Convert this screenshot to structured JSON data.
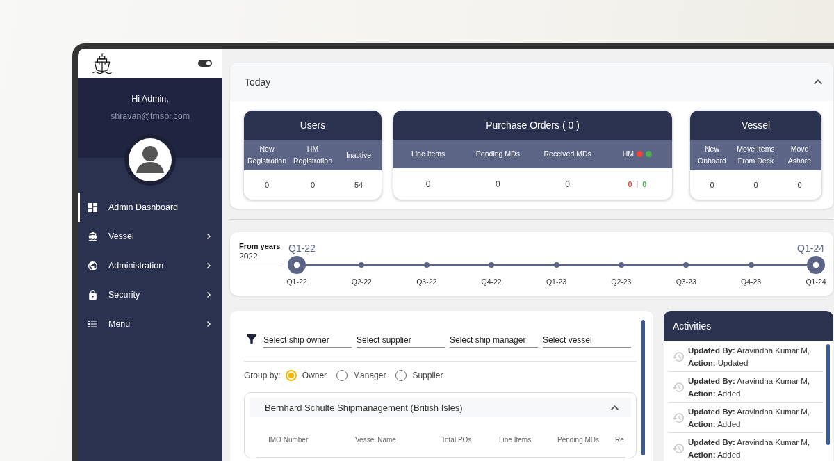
{
  "sidebar": {
    "theme_toggle": {
      "on": true
    },
    "greeting": "Hi Admin,",
    "email": "shravan@tmspl.com",
    "items": [
      {
        "label": "Admin Dashboard",
        "selected": true,
        "has_submenu": false
      },
      {
        "label": "Vessel",
        "selected": false,
        "has_submenu": true
      },
      {
        "label": "Administration",
        "selected": false,
        "has_submenu": true
      },
      {
        "label": "Security",
        "selected": false,
        "has_submenu": true
      },
      {
        "label": "Menu",
        "selected": false,
        "has_submenu": true
      }
    ]
  },
  "today": {
    "title": "Today",
    "expanded": true,
    "cards": [
      {
        "title": "Users",
        "columns": [
          {
            "kind": "plain",
            "label": "New Registration",
            "value": "0"
          },
          {
            "kind": "plain",
            "label": "HM Registration",
            "value": "0"
          },
          {
            "kind": "plain",
            "label": "Inactive",
            "value": "54"
          }
        ]
      },
      {
        "title": "Purchase Orders ( 0 )",
        "columns": [
          {
            "kind": "plain",
            "label": "Line Items",
            "value": "0"
          },
          {
            "kind": "plain",
            "label": "Pending MDs",
            "value": "0"
          },
          {
            "kind": "plain",
            "label": "Received MDs",
            "value": "0"
          },
          {
            "kind": "split",
            "label": "HM",
            "separator": "|",
            "indicators": [
              {
                "color": "#f44336",
                "value": "0"
              },
              {
                "color": "#4caf50",
                "value": "0"
              }
            ]
          }
        ]
      },
      {
        "title": "Vessel",
        "columns": [
          {
            "kind": "plain",
            "label": "New Onboard",
            "value": "0"
          },
          {
            "kind": "plain",
            "label": "Move Items From Deck",
            "value": "0"
          },
          {
            "kind": "plain",
            "label": "Move Ashore",
            "value": "0"
          }
        ]
      }
    ]
  },
  "timeline": {
    "from_field": {
      "label": "From years",
      "value": "2022"
    },
    "range": {
      "start_reading": "Q1-22",
      "end_reading": "Q1-24"
    },
    "marks": [
      {
        "label": "Q1-22",
        "selected": true
      },
      {
        "label": "Q2-22",
        "selected": false
      },
      {
        "label": "Q3-22",
        "selected": false
      },
      {
        "label": "Q4-22",
        "selected": false
      },
      {
        "label": "Q1-23",
        "selected": false
      },
      {
        "label": "Q2-23",
        "selected": false
      },
      {
        "label": "Q3-23",
        "selected": false
      },
      {
        "label": "Q4-23",
        "selected": false
      },
      {
        "label": "Q1-24",
        "selected": true
      }
    ]
  },
  "filters": {
    "fields": [
      {
        "placeholder": "Select ship owner"
      },
      {
        "placeholder": "Select supplier"
      },
      {
        "placeholder": "Select ship manager"
      },
      {
        "placeholder": "Select vessel"
      }
    ],
    "group_by": {
      "label": "Group by:",
      "options": [
        {
          "label": "Owner",
          "selected": true
        },
        {
          "label": "Manager",
          "selected": false
        },
        {
          "label": "Supplier",
          "selected": false
        }
      ]
    },
    "groups": [
      {
        "title": "Bernhard Schulte Shipmanagement (British Isles)",
        "expanded": true,
        "table": {
          "columns": [
            "IMO Number",
            "Vessel Name",
            "Total POs",
            "Line Items",
            "Pending MDs",
            "Re"
          ]
        }
      }
    ]
  },
  "activities": {
    "title": "Activities",
    "items": [
      {
        "line_1": "**Updated By:** Aravindha Kumar M,",
        "line_2": "**Action:** Updated"
      },
      {
        "line_1": "**Updated By:** Aravindha Kumar M,",
        "line_2": "**Action:** Added"
      },
      {
        "line_1": "**Updated By:** Aravindha Kumar M,",
        "line_2": "**Action:** Added"
      },
      {
        "line_1": "**Updated By:** Aravindha Kumar M,",
        "line_2": "**Action:** Added"
      }
    ]
  }
}
